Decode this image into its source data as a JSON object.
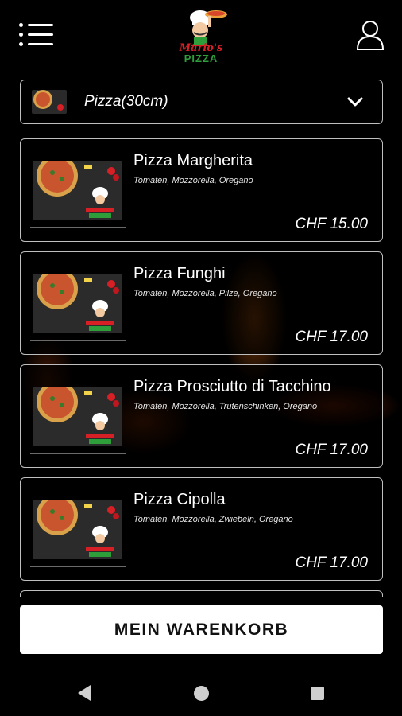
{
  "header": {
    "logo": {
      "line1": "Mario's",
      "line2": "PIZZA"
    }
  },
  "category": {
    "selected": "Pizza(30cm)"
  },
  "menu_items": [
    {
      "name": "Pizza Margherita",
      "ingredients": "Tomaten, Mozzorella, Oregano",
      "price": "CHF 15.00"
    },
    {
      "name": "Pizza Funghi",
      "ingredients": "Tomaten, Mozzorella, Pilze, Oregano",
      "price": "CHF 17.00"
    },
    {
      "name": "Pizza Prosciutto di Tacchino",
      "ingredients": "Tomaten, Mozzorella, Trutenschinken, Oregano",
      "price": "CHF 17.00"
    },
    {
      "name": "Pizza Cipolla",
      "ingredients": "Tomaten, Mozzorella, Zwiebeln, Oregano",
      "price": "CHF 17.00"
    }
  ],
  "cart": {
    "label": "MEIN WARENKORB"
  },
  "colors": {
    "background": "#000000",
    "brand_red": "#d71f26",
    "brand_green": "#2e9e3b",
    "border": "#bfbfbf"
  }
}
